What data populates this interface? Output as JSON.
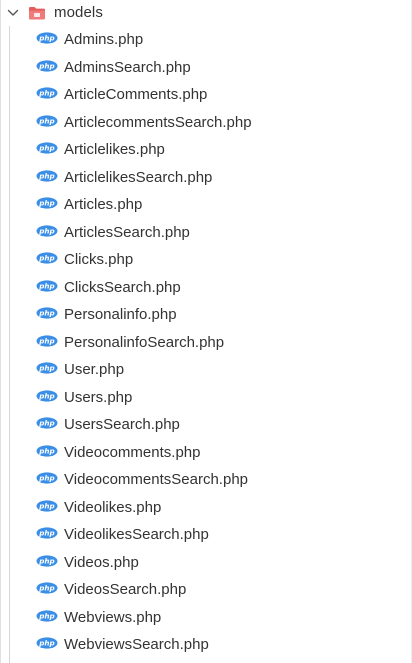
{
  "folder": {
    "name": "models",
    "expanded": true,
    "icon": "folder-red-icon",
    "icon_color": "#e05252"
  },
  "file_icon": {
    "name": "php-icon",
    "text": "php",
    "color": "#3a8ee6"
  },
  "files": [
    {
      "label": "Admins.php"
    },
    {
      "label": "AdminsSearch.php"
    },
    {
      "label": "ArticleComments.php"
    },
    {
      "label": "ArticlecommentsSearch.php"
    },
    {
      "label": "Articlelikes.php"
    },
    {
      "label": "ArticlelikesSearch.php"
    },
    {
      "label": "Articles.php"
    },
    {
      "label": "ArticlesSearch.php"
    },
    {
      "label": "Clicks.php"
    },
    {
      "label": "ClicksSearch.php"
    },
    {
      "label": "Personalinfo.php"
    },
    {
      "label": "PersonalinfoSearch.php"
    },
    {
      "label": "User.php"
    },
    {
      "label": "Users.php"
    },
    {
      "label": "UsersSearch.php"
    },
    {
      "label": "Videocomments.php"
    },
    {
      "label": "VideocommentsSearch.php"
    },
    {
      "label": "Videolikes.php"
    },
    {
      "label": "VideolikesSearch.php"
    },
    {
      "label": "Videos.php"
    },
    {
      "label": "VideosSearch.php"
    },
    {
      "label": "Webviews.php"
    },
    {
      "label": "WebviewsSearch.php"
    }
  ]
}
